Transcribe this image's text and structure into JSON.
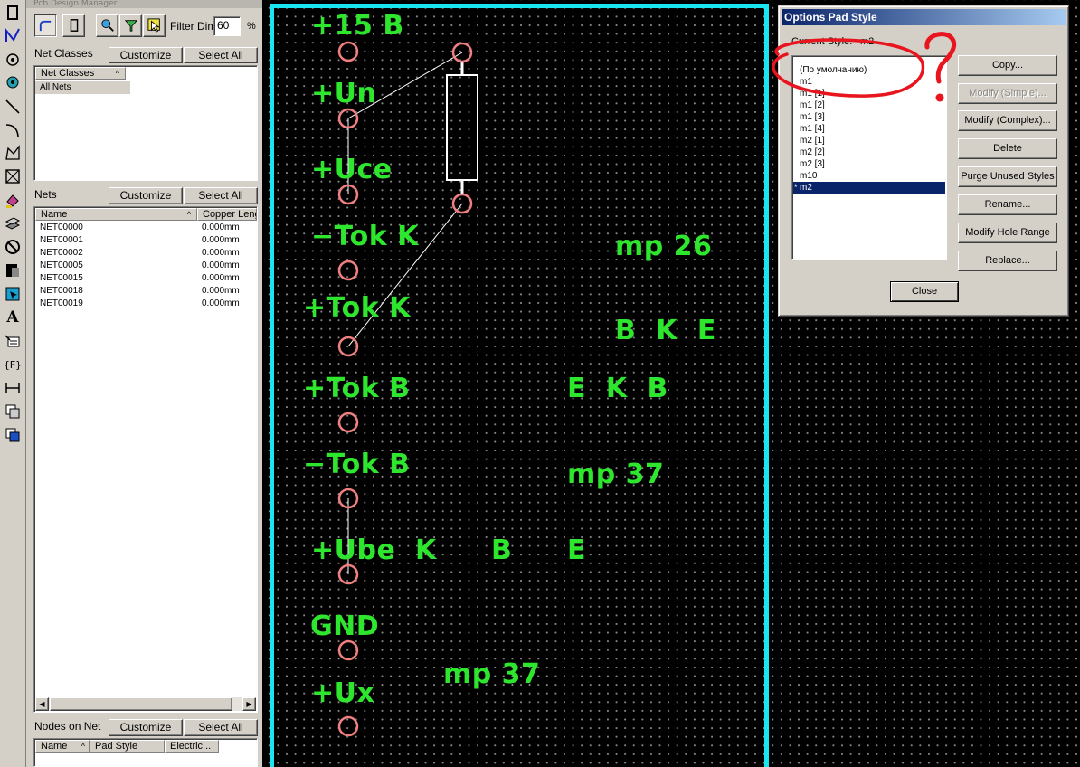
{
  "toolbar": {
    "icons": [
      "select-tool",
      "route-tool",
      "pad-tool",
      "via-tool",
      "line-tool",
      "arc-tool",
      "polygon-tool",
      "rect-tool",
      "fill-tool",
      "layer-tool",
      "keepout-tool",
      "copper-tool",
      "copper-pour-tool",
      "text-tool",
      "attribute-tool",
      "field-tool",
      "dimension-tool",
      "layer-stack-tool",
      "layer-stack2-tool"
    ],
    "text_glyphs": {
      "text": "A",
      "field": "{F}"
    }
  },
  "manager": {
    "title": "Pcb Design Manager",
    "filter_label": "Filter Dim:",
    "filter_value": "60",
    "filter_unit": "%",
    "net_classes": {
      "label": "Net Classes",
      "customize": "Customize",
      "select_all": "Select All",
      "header": "Net Classes",
      "rows": [
        "All Nets"
      ]
    },
    "nets": {
      "label": "Nets",
      "customize": "Customize",
      "select_all": "Select All",
      "col_name": "Name",
      "col_copper": "Copper Leng",
      "rows": [
        {
          "name": "NET00000",
          "len": "0.000mm"
        },
        {
          "name": "NET00001",
          "len": "0.000mm"
        },
        {
          "name": "NET00002",
          "len": "0.000mm"
        },
        {
          "name": "NET00005",
          "len": "0.000mm"
        },
        {
          "name": "NET00015",
          "len": "0.000mm"
        },
        {
          "name": "NET00018",
          "len": "0.000mm"
        },
        {
          "name": "NET00019",
          "len": "0.000mm"
        }
      ]
    },
    "nodes": {
      "label": "Nodes on Net",
      "customize": "Customize",
      "select_all": "Select All",
      "col_name": "Name",
      "col_pad": "Pad Style",
      "col_elec": "Electric..."
    }
  },
  "board": {
    "outline_color": "#19e6f0",
    "silk_color": "#2ee62e",
    "pad_color": "#f08080",
    "labels": [
      {
        "id": "label-15b",
        "text": "+15 B"
      },
      {
        "id": "label-un",
        "text": "+Un"
      },
      {
        "id": "label-uce",
        "text": "+Uce"
      },
      {
        "id": "label-tok-k-neg",
        "text": "−Tok K"
      },
      {
        "id": "label-tok-k-pos",
        "text": "+Tok K"
      },
      {
        "id": "label-tok-b-pos",
        "text": "+Tok B"
      },
      {
        "id": "label-tok-b-neg",
        "text": "−Tok B"
      },
      {
        "id": "label-ube",
        "text": "+Ube"
      },
      {
        "id": "label-gnd",
        "text": "GND"
      },
      {
        "id": "label-ux",
        "text": "+Ux"
      },
      {
        "id": "label-mp26",
        "text": "mp 26"
      },
      {
        "id": "label-bke",
        "text": "B  K  E"
      },
      {
        "id": "label-ekb",
        "text": "E  K  B"
      },
      {
        "id": "label-mp37-a",
        "text": "mp 37"
      },
      {
        "id": "label-ube-k",
        "text": "K"
      },
      {
        "id": "label-ube-b",
        "text": "B"
      },
      {
        "id": "label-ube-e",
        "text": "E"
      },
      {
        "id": "label-mp37-b",
        "text": "mp 37"
      }
    ]
  },
  "dialog": {
    "title": "Options Pad Style",
    "current_style_label": "Current Style:",
    "current_style_value": "m2",
    "styles": [
      "(По умолчанию)",
      "m1",
      "m1 [1]",
      "m1 [2]",
      "m1 [3]",
      "m1 [4]",
      "m2 [1]",
      "m2 [2]",
      "m2 [3]",
      "m10",
      "m2"
    ],
    "selected_index": 10,
    "selected_mark": "*",
    "buttons": {
      "copy": "Copy...",
      "modify_simple": "Modify (Simple)...",
      "modify_complex": "Modify (Complex)...",
      "delete": "Delete",
      "purge": "Purge Unused Styles",
      "rename": "Rename...",
      "hole_range": "Modify Hole Range",
      "replace": "Replace...",
      "close": "Close"
    },
    "annotation": {
      "mark": "?",
      "color": "#e8141e"
    }
  }
}
